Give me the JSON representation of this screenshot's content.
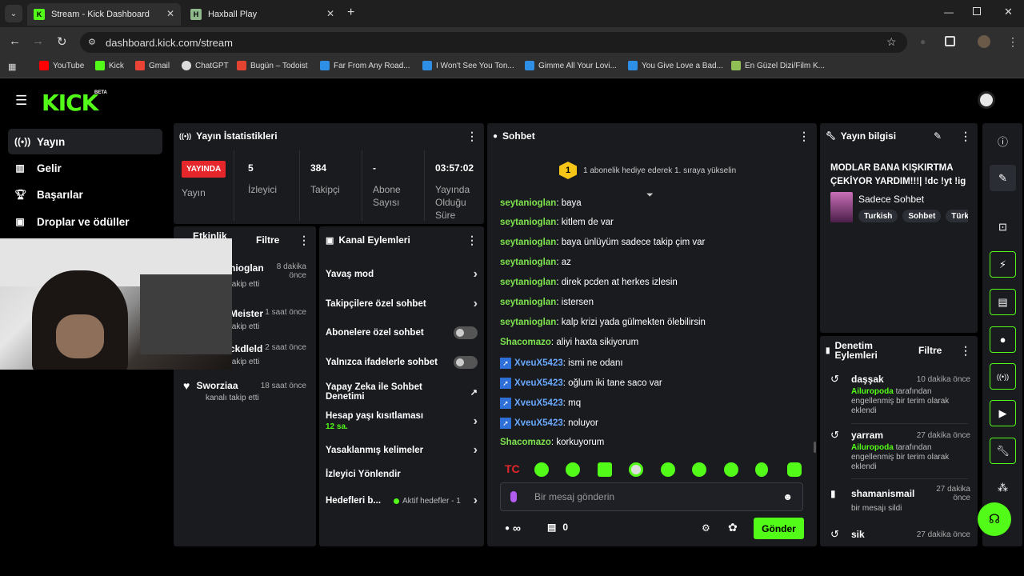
{
  "browser": {
    "tabs": [
      {
        "title": "Stream - Kick Dashboard"
      },
      {
        "title": "Haxball Play"
      }
    ],
    "url": "dashboard.kick.com/stream",
    "bookmarks": [
      "YouTube",
      "Kick",
      "Gmail",
      "ChatGPT",
      "Bugün – Todoist",
      "Far From Any Road...",
      "I Won't See You Ton...",
      "Gimme All Your Lovi...",
      "You Give Love a Bad...",
      "En Güzel Dizi/Film K..."
    ]
  },
  "brand": {
    "logo": "KICK",
    "beta": "BETA",
    "accent": "#53fc18"
  },
  "sidebar": {
    "items": [
      {
        "label": "Yayın",
        "icon": "broadcast-icon"
      },
      {
        "label": "Gelir",
        "icon": "chart-icon"
      },
      {
        "label": "Başarılar",
        "icon": "trophy-icon"
      },
      {
        "label": "Droplar ve ödüller",
        "icon": "gift-icon"
      }
    ]
  },
  "stats": {
    "title": "Yayın İstatistikleri",
    "live_badge": "YAYINDA",
    "live_label": "Yayın",
    "items": [
      {
        "value": "5",
        "label": "İzleyici"
      },
      {
        "value": "384",
        "label": "Takipçi"
      },
      {
        "value": "-",
        "label": "Abone Sayısı"
      },
      {
        "value": "03:57:02",
        "label": "Yayında Olduğu Süre"
      }
    ]
  },
  "activity": {
    "title": "Etkinlik",
    "filter": "Filtre",
    "items": [
      {
        "name": "nioglan",
        "time": "8 dakika önce",
        "text": "takip etti"
      },
      {
        "name": "Meister",
        "time": "1 saat önce",
        "text": "takip etti"
      },
      {
        "name": "ckdleld",
        "time": "2 saat önce",
        "text": "takip etti"
      },
      {
        "name": "Sworziaa",
        "time": "18 saat önce",
        "text": "kanalı takip etti"
      }
    ]
  },
  "channel_actions": {
    "title": "Kanal Eylemleri",
    "items": [
      {
        "label": "Yavaş mod"
      },
      {
        "label": "Takipçilere özel sohbet"
      },
      {
        "label": "Abonelere özel sohbet"
      },
      {
        "label": "Yalnızca ifadelerle sohbet"
      },
      {
        "label": "Yapay Zeka ile Sohbet Denetimi"
      },
      {
        "label": "Hesap yaşı kısıtlaması",
        "sub": "12 sa."
      },
      {
        "label": "Yasaklanmış kelimeler"
      },
      {
        "label": "İzleyici Yönlendir"
      },
      {
        "label": "Hedefleri b...",
        "sub": "Aktif hedefler - 1"
      }
    ]
  },
  "chat": {
    "title": "Sohbet",
    "banner_rank": "1",
    "banner": "1 abonelik hediye ederek 1. sıraya yükselin",
    "messages": [
      {
        "user": "seytanioglan",
        "text": "baya"
      },
      {
        "user": "seytanioglan",
        "text": "kitlem de var"
      },
      {
        "user": "seytanioglan",
        "text": "baya ünlüyüm sadece takip çim var"
      },
      {
        "user": "seytanioglan",
        "text": "az"
      },
      {
        "user": "seytanioglan",
        "text": "direk pcden at herkes izlesin"
      },
      {
        "user": "seytanioglan",
        "text": "istersen"
      },
      {
        "user": "seytanioglan",
        "text": "kalp krizi yada gülmekten ölebilirsin"
      },
      {
        "user": "Shacomazo",
        "text": "aliyi haxta sikiyorum"
      },
      {
        "user": "XveuX5423",
        "text": "ismi ne odanı"
      },
      {
        "user": "XveuX5423",
        "text": "oğlum iki tane saco var"
      },
      {
        "user": "XveuX5423",
        "text": "mq"
      },
      {
        "user": "XveuX5423",
        "text": "noluyor"
      },
      {
        "user": "Shacomazo",
        "text": "korkuyorum"
      }
    ],
    "input_placeholder": "Bir mesaj gönderin",
    "points": "∞",
    "store_count": "0",
    "send_label": "Gönder"
  },
  "stream_info": {
    "title": "Yayın bilgisi",
    "stream_title": "MODLAR BANA KIŞKIRTMA ÇEKİYOR YARDIM!!!| !dc !yt !ig",
    "category": "Sadece Sohbet",
    "tags": [
      "Turkish",
      "Sohbet",
      "Türk"
    ]
  },
  "moderation": {
    "title": "Denetim Eylemleri",
    "filter": "Filtre",
    "items": [
      {
        "name": "daşşak",
        "time": "10 dakika önce",
        "actor": "Ailuropoda",
        "text": "tarafından engellenmiş bir terim olarak eklendi"
      },
      {
        "name": "yarram",
        "time": "27 dakika önce",
        "actor": "Ailuropoda",
        "text": "tarafından engellenmiş bir terim olarak eklendi"
      },
      {
        "name": "shamanismail",
        "time": "27 dakika önce",
        "actor": "",
        "text": "bir mesajı sildi"
      },
      {
        "name": "sik",
        "time": "27 dakika önce",
        "actor": "",
        "text": ""
      }
    ]
  }
}
